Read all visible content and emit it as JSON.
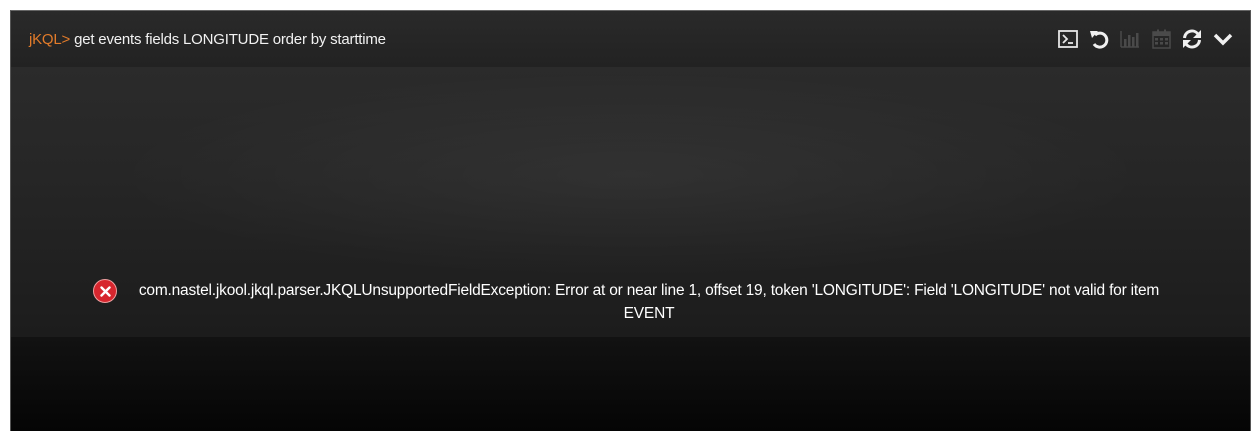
{
  "header": {
    "prompt": "jKQL>",
    "query": "get events fields LONGITUDE order by starttime"
  },
  "toolbar": {
    "icons": [
      "console-icon",
      "undo-icon",
      "bar-chart-icon",
      "calendar-icon",
      "refresh-icon",
      "chevron-down-icon"
    ]
  },
  "error": {
    "message": "com.nastel.jkool.jkql.parser.JKQLUnsupportedFieldException: Error at or near line 1, offset 19, token 'LONGITUDE': Field 'LONGITUDE' not valid for item EVENT"
  },
  "colors": {
    "prompt": "#e27b2a",
    "error_icon": "#d7262e",
    "header_bg": "#252525",
    "panel_bg": "#262626"
  }
}
